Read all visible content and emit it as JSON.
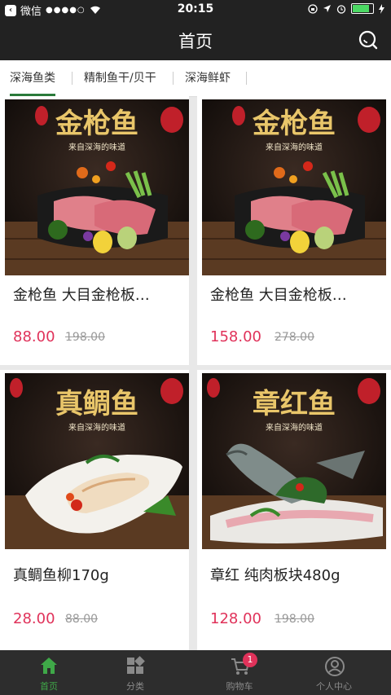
{
  "status": {
    "carrier": "微信",
    "signal": "●●●●○",
    "time": "20:15"
  },
  "navbar": {
    "title": "首页"
  },
  "tabs": [
    {
      "label": "深海鱼类",
      "active": true
    },
    {
      "label": "精制鱼干/贝干",
      "active": false
    },
    {
      "label": "深海鲜虾",
      "active": false
    }
  ],
  "products": [
    {
      "name": "金枪鱼 大目金枪板…",
      "price": "88.00",
      "original_price": "198.00",
      "banner": "金枪鱼",
      "tagline": "来自深海的味道"
    },
    {
      "name": "金枪鱼 大目金枪板…",
      "price": "158.00",
      "original_price": "278.00",
      "banner": "金枪鱼",
      "tagline": "来自深海的味道"
    },
    {
      "name": "真鲷鱼柳170g",
      "price": "28.00",
      "original_price": "88.00",
      "banner": "真鲷鱼",
      "tagline": "来自深海的味道"
    },
    {
      "name": "章红 纯肉板块480g",
      "price": "128.00",
      "original_price": "198.00",
      "banner": "章红鱼",
      "tagline": "来自深海的味道"
    }
  ],
  "tabbar": {
    "items": [
      {
        "label": "首页",
        "icon": "home-icon",
        "active": true
      },
      {
        "label": "分类",
        "icon": "category-icon",
        "active": false
      },
      {
        "label": "购物车",
        "icon": "cart-icon",
        "active": false,
        "badge": "1"
      },
      {
        "label": "个人中心",
        "icon": "user-icon",
        "active": false
      }
    ]
  },
  "colors": {
    "accent": "#3fa848",
    "price": "#e0325a",
    "bar": "#222222"
  }
}
